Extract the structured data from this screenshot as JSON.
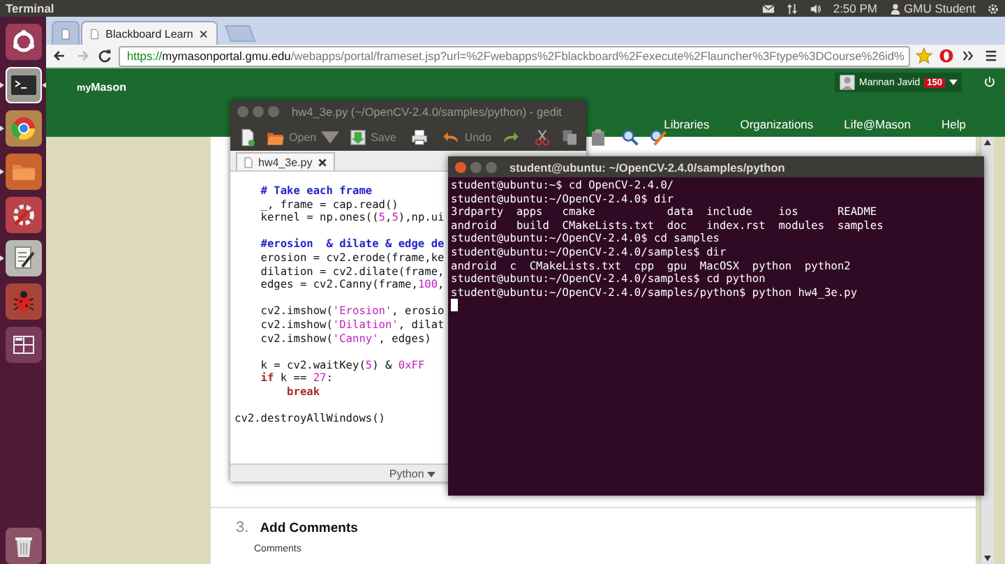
{
  "top_panel": {
    "app_name": "Terminal",
    "clock": "2:50 PM",
    "user": "GMU Student"
  },
  "launcher": [
    {
      "kind": "dash",
      "running": false,
      "active": false
    },
    {
      "kind": "terminal",
      "running": true,
      "active": true
    },
    {
      "kind": "browser",
      "running": true,
      "active": false
    },
    {
      "kind": "files",
      "running": true,
      "active": false
    },
    {
      "kind": "settings",
      "running": false,
      "active": false
    },
    {
      "kind": "editor",
      "running": true,
      "active": false
    },
    {
      "kind": "bug",
      "running": false,
      "active": false
    },
    {
      "kind": "workspaces",
      "running": false,
      "active": false
    },
    {
      "kind": "trash",
      "running": false,
      "active": false
    }
  ],
  "browser": {
    "tabs": [
      {
        "selected": false
      },
      {
        "title": "Blackboard Learn",
        "selected": true
      }
    ],
    "url_scheme": "https://",
    "url_host": "mymasonportal.gmu.edu",
    "url_path": "/webapps/portal/frameset.jsp?url=%2Fwebapps%2Fblackboard%2Fexecute%2Flauncher%3Ftype%3DCourse%26id%"
  },
  "portal": {
    "logo": {
      "prefix": "my",
      "name": "Mason"
    },
    "user": {
      "name": "Mannan Javid",
      "badge": "150"
    },
    "nav": [
      "Libraries",
      "Organizations",
      "Life@Mason",
      "Help"
    ],
    "section": {
      "number": "3.",
      "title": "Add Comments",
      "label": "Comments"
    }
  },
  "gedit": {
    "title": "hw4_3e.py (~/OpenCV-2.4.0/samples/python) - gedit",
    "toolbar": [
      {
        "kind": "new"
      },
      {
        "kind": "open",
        "label": "Open"
      },
      {
        "kind": "save",
        "label": "Save"
      },
      {
        "kind": "print"
      },
      {
        "kind": "undo",
        "label": "Undo"
      },
      {
        "kind": "redo"
      },
      {
        "kind": "cut"
      },
      {
        "kind": "copy"
      },
      {
        "kind": "paste"
      },
      {
        "kind": "find"
      },
      {
        "kind": "replace"
      }
    ],
    "tab": "hw4_3e.py",
    "code": [
      [
        [
          {
            "text": "    # Take each frame",
            "kind": "comment"
          }
        ],
        [
          {
            "text": "    _, frame = cap.read()",
            "kind": "plain"
          }
        ],
        [
          {
            "text": "    kernel = np.ones((",
            "kind": "plain"
          },
          {
            "text": "5",
            "kind": "number"
          },
          {
            "text": ",",
            "kind": "plain"
          },
          {
            "text": "5",
            "kind": "number"
          },
          {
            "text": "),np.ui",
            "kind": "plain"
          }
        ]
      ],
      [
        [
          {
            "text": "    #erosion  & dilate & edge de",
            "kind": "comment"
          }
        ],
        [
          {
            "text": "    erosion = cv2.erode(frame,ke",
            "kind": "plain"
          }
        ],
        [
          {
            "text": "    dilation = cv2.dilate(frame,",
            "kind": "plain"
          }
        ],
        [
          {
            "text": "    edges = cv2.Canny(frame,",
            "kind": "plain"
          },
          {
            "text": "100",
            "kind": "number"
          },
          {
            "text": ",",
            "kind": "plain"
          }
        ]
      ],
      [
        [
          {
            "text": "    cv2.imshow(",
            "kind": "plain"
          },
          {
            "text": "'Erosion'",
            "kind": "string"
          },
          {
            "text": ", erosio",
            "kind": "plain"
          }
        ],
        [
          {
            "text": "    cv2.imshow(",
            "kind": "plain"
          },
          {
            "text": "'Dilation'",
            "kind": "string"
          },
          {
            "text": ", dilat",
            "kind": "plain"
          }
        ],
        [
          {
            "text": "    cv2.imshow(",
            "kind": "plain"
          },
          {
            "text": "'Canny'",
            "kind": "string"
          },
          {
            "text": ", edges)",
            "kind": "plain"
          }
        ]
      ],
      [
        [
          {
            "text": "    k = cv2.waitKey(",
            "kind": "plain"
          },
          {
            "text": "5",
            "kind": "number"
          },
          {
            "text": ") & ",
            "kind": "plain"
          },
          {
            "text": "0xFF",
            "kind": "number"
          }
        ],
        [
          {
            "text": "    if",
            "kind": "keyword"
          },
          {
            "text": " k == ",
            "kind": "plain"
          },
          {
            "text": "27",
            "kind": "number"
          },
          {
            "text": ":",
            "kind": "plain"
          }
        ],
        [
          {
            "text": "        break",
            "kind": "keyword"
          }
        ]
      ],
      [
        [
          {
            "text": "cv2.destroyAllWindows()",
            "kind": "plain"
          }
        ]
      ]
    ],
    "language": "Python"
  },
  "terminal": {
    "title": "student@ubuntu: ~/OpenCV-2.4.0/samples/python",
    "lines": [
      "student@ubuntu:~$ cd OpenCV-2.4.0/",
      "student@ubuntu:~/OpenCV-2.4.0$ dir",
      "3rdparty  apps   cmake           data  include    ios      README",
      "android   build  CMakeLists.txt  doc   index.rst  modules  samples",
      "student@ubuntu:~/OpenCV-2.4.0$ cd samples",
      "student@ubuntu:~/OpenCV-2.4.0/samples$ dir",
      "android  c  CMakeLists.txt  cpp  gpu  MacOSX  python  python2",
      "student@ubuntu:~/OpenCV-2.4.0/samples$ cd python",
      "student@ubuntu:~/OpenCV-2.4.0/samples/python$ python hw4_3e.py"
    ]
  }
}
